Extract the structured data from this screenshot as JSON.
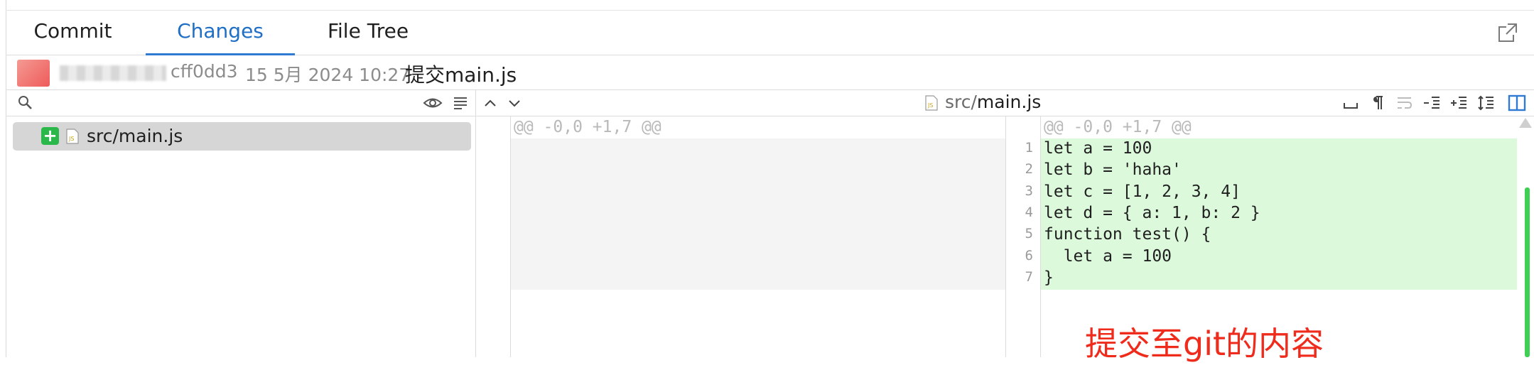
{
  "tabs": [
    {
      "label": "Commit"
    },
    {
      "label": "Changes"
    },
    {
      "label": "File Tree"
    }
  ],
  "commit": {
    "hash": "cff0dd3",
    "date": "15 5月 2024 10:27",
    "message": "提交main.js"
  },
  "file_list": [
    {
      "status": "+",
      "name": "src/main.js"
    }
  ],
  "diff": {
    "file_dir": "src/",
    "file_base": "main.js",
    "hunk_header": "@@ -0,0 +1,7 @@",
    "lines": [
      {
        "no": "1",
        "code": "let a = 100"
      },
      {
        "no": "2",
        "code": "let b = 'haha'"
      },
      {
        "no": "3",
        "code": "let c = [1, 2, 3, 4]"
      },
      {
        "no": "4",
        "code": "let d = { a: 1, b: 2 }"
      },
      {
        "no": "5",
        "code": "function test() {"
      },
      {
        "no": "6",
        "code": "  let a = 100"
      },
      {
        "no": "7",
        "code": "}"
      }
    ]
  },
  "annotation": "提交至git的内容",
  "colors": {
    "accent": "#1e6fc5",
    "added_bg": "#ddf9dc",
    "added_badge": "#2bb84a",
    "annotation": "#ef2b1c"
  }
}
